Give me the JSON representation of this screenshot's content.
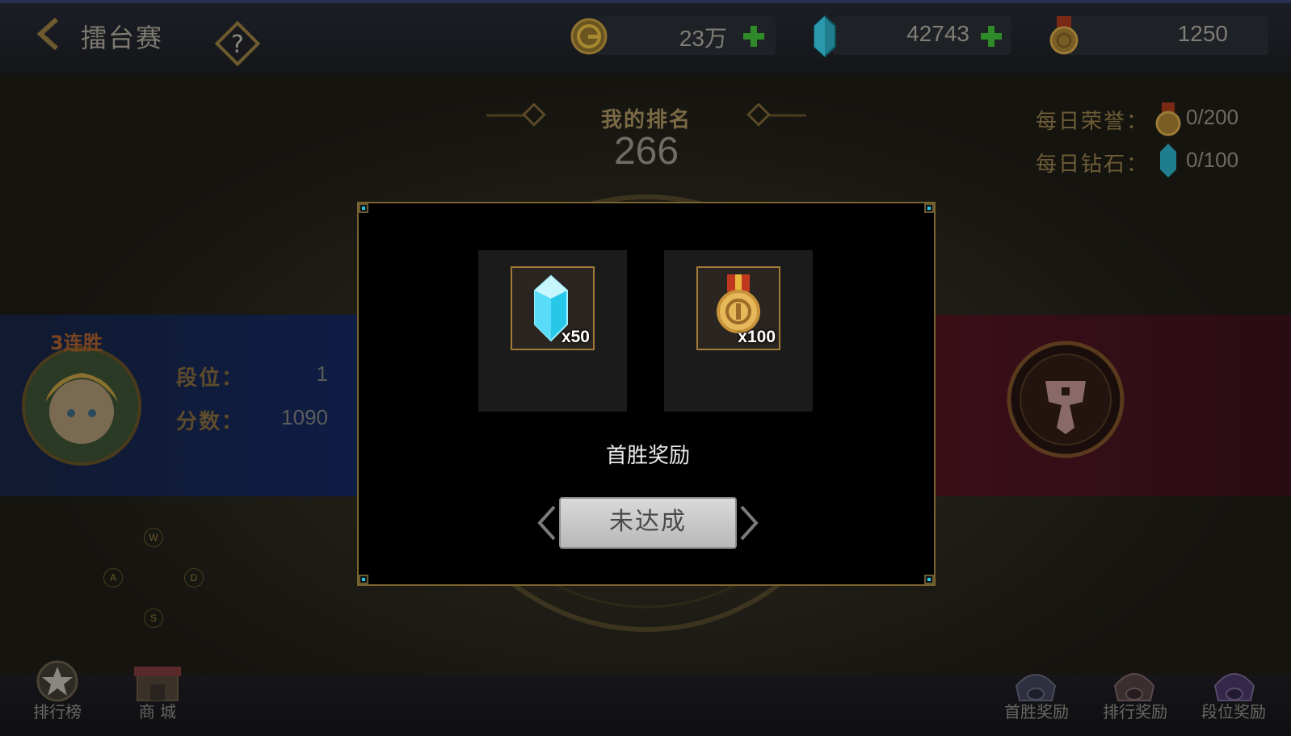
{
  "header": {
    "title": "擂台赛"
  },
  "resources": {
    "gold": {
      "value": "23万"
    },
    "diamond": {
      "value": "42743"
    },
    "honor": {
      "value": "1250"
    }
  },
  "ranking": {
    "label": "我的排名",
    "value": "266"
  },
  "daily": {
    "honor": {
      "label": "每日荣誉：",
      "value": "0/200"
    },
    "diamond": {
      "label": "每日钻石：",
      "value": "0/100"
    }
  },
  "player": {
    "streak": "3连胜",
    "rank_label": "段位：",
    "rank_value": "1",
    "score_label": "分数：",
    "score_value": "1090"
  },
  "keys": [
    "W",
    "A",
    "D",
    "S"
  ],
  "bottom_nav": {
    "leaderboard": "排行榜",
    "shop": "商 城",
    "first_win_reward": "首胜奖励",
    "rank_reward": "排行奖励",
    "tier_reward": "段位奖励"
  },
  "modal": {
    "rewards": [
      {
        "icon": "diamond-icon",
        "count": "x50"
      },
      {
        "icon": "medal-icon",
        "count": "x100"
      }
    ],
    "title": "首胜奖励",
    "status_button": "未达成"
  },
  "colors": {
    "accent_gold": "#a27a37",
    "corner_cyan": "#29c6df",
    "plus_green": "#2f8a2a",
    "team_blue": "#0f1d45",
    "team_red": "#3a0f18"
  }
}
